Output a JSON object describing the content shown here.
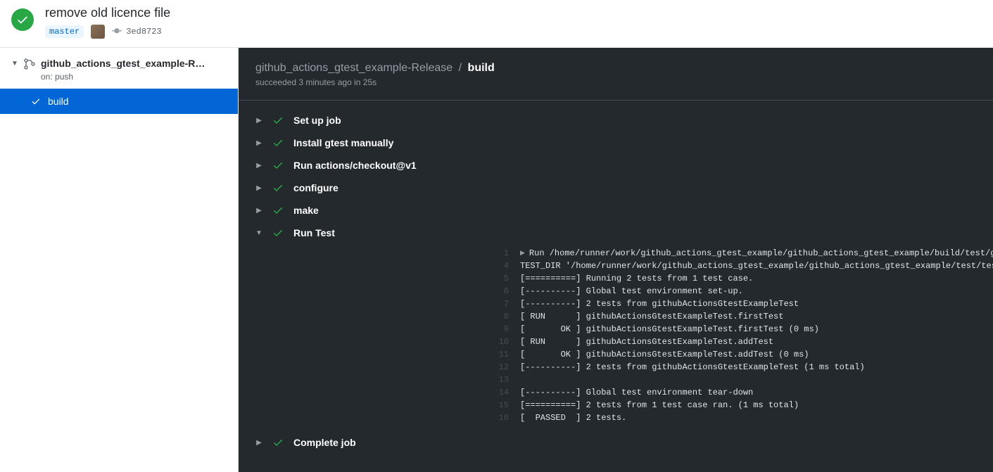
{
  "header": {
    "commit_title": "remove old licence file",
    "branch": "master",
    "commit_hash": "3ed8723"
  },
  "sidebar": {
    "workflow_name": "github_actions_gtest_example-R…",
    "trigger": "on: push",
    "job_name": "build"
  },
  "content": {
    "breadcrumb_workflow": "github_actions_gtest_example-Release",
    "breadcrumb_sep": "/",
    "breadcrumb_job": "build",
    "status_text": "succeeded 3 minutes ago in 25s",
    "steps": [
      {
        "name": "Set up job",
        "expanded": false
      },
      {
        "name": "Install gtest manually",
        "expanded": false
      },
      {
        "name": "Run actions/checkout@v1",
        "expanded": false
      },
      {
        "name": "configure",
        "expanded": false
      },
      {
        "name": "make",
        "expanded": false
      },
      {
        "name": "Run Test",
        "expanded": true
      },
      {
        "name": "Complete job",
        "expanded": false
      }
    ],
    "log": [
      {
        "n": "1",
        "t": "Run /home/runner/work/github_actions_gtest_example/github_actions_gtest_example/build/test/github_actions_gtest_example.test",
        "caret": true
      },
      {
        "n": "4",
        "t": "TEST_DIR '/home/runner/work/github_actions_gtest_example/github_actions_gtest_example/test/test'"
      },
      {
        "n": "5",
        "t": "[==========] Running 2 tests from 1 test case."
      },
      {
        "n": "6",
        "t": "[----------] Global test environment set-up."
      },
      {
        "n": "7",
        "t": "[----------] 2 tests from githubActionsGtestExampleTest"
      },
      {
        "n": "8",
        "t": "[ RUN      ] githubActionsGtestExampleTest.firstTest"
      },
      {
        "n": "9",
        "t": "[       OK ] githubActionsGtestExampleTest.firstTest (0 ms)"
      },
      {
        "n": "10",
        "t": "[ RUN      ] githubActionsGtestExampleTest.addTest"
      },
      {
        "n": "11",
        "t": "[       OK ] githubActionsGtestExampleTest.addTest (0 ms)"
      },
      {
        "n": "12",
        "t": "[----------] 2 tests from githubActionsGtestExampleTest (1 ms total)"
      },
      {
        "n": "13",
        "t": ""
      },
      {
        "n": "14",
        "t": "[----------] Global test environment tear-down"
      },
      {
        "n": "15",
        "t": "[==========] 2 tests from 1 test case ran. (1 ms total)"
      },
      {
        "n": "16",
        "t": "[  PASSED  ] 2 tests."
      }
    ]
  }
}
